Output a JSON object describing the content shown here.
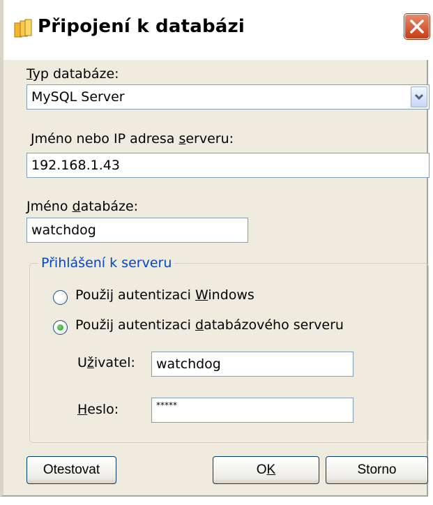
{
  "window": {
    "title": "Připojení k databázi",
    "close_glyph": "✕"
  },
  "db_type": {
    "label_pre": "",
    "label_key": "T",
    "label_post": "yp databáze:",
    "value": "MySQL Server"
  },
  "server": {
    "label_pre": "Jméno nebo IP adresa ",
    "label_key": "s",
    "label_post": "erveru:",
    "value": "192.168.1.43"
  },
  "database": {
    "label_pre": "Jméno ",
    "label_key": "d",
    "label_post": "atabáze:",
    "value": "watchdog"
  },
  "login": {
    "legend": "Přihlášení k serveru",
    "radio_windows": {
      "pre": "Použij autentizaci ",
      "key": "W",
      "post": "indows",
      "selected": false
    },
    "radio_db": {
      "pre": "Použij autentizaci ",
      "key": "d",
      "post": "atabázového serveru",
      "selected": true
    },
    "user_label_pre": "U",
    "user_label_key": "ž",
    "user_label_post": "ivatel:",
    "user_value": "watchdog",
    "password_label_pre": "",
    "password_label_key": "H",
    "password_label_post": "eslo:",
    "password_value": "*****"
  },
  "buttons": {
    "test_label": "Otestovat",
    "ok_pre": "O",
    "ok_key": "K",
    "cancel_label": "Storno"
  },
  "colors": {
    "dialog_bg": "#efebde",
    "legend_text": "#0046d5",
    "close_button": "#c73b18",
    "field_border": "#7f9db9"
  }
}
